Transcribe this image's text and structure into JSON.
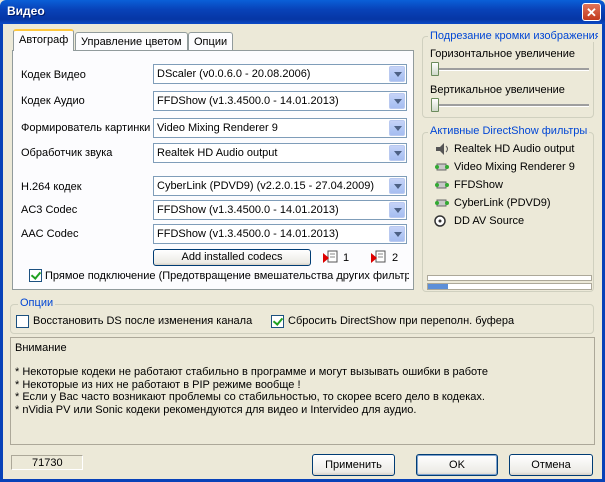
{
  "window": {
    "title": "Видео",
    "close": "✕"
  },
  "tabs": [
    {
      "label": "Автограф"
    },
    {
      "label": "Управление цветом"
    },
    {
      "label": "Опции"
    }
  ],
  "form": {
    "video_codec": {
      "label": "Кодек Видео",
      "value": "DScaler   (v0.0.6.0 - 20.08.2006)"
    },
    "audio_codec": {
      "label": "Кодек Аудио",
      "value": "FFDShow   (v1.3.4500.0 - 14.01.2013)"
    },
    "renderer": {
      "label": "Формирователь картинки",
      "value": "Video Mixing Renderer 9"
    },
    "audio_handler": {
      "label": "Обработчик звука",
      "value": "Realtek HD Audio output"
    },
    "h264": {
      "label": "H.264 кодек",
      "value": "CyberLink (PDVD9)   (v2.2.0.15 - 27.04.2009)"
    },
    "ac3": {
      "label": "AC3 Codec",
      "value": "FFDShow   (v1.3.4500.0 - 14.01.2013)"
    },
    "aac": {
      "label": "AAC Codec",
      "value": "FFDShow   (v1.3.4500.0 - 14.01.2013)"
    },
    "add_codecs_label": "Add installed codecs",
    "counter1": "1",
    "counter2": "2",
    "direct_connect": {
      "label": "Прямое подключение (Предотвращение вмешательства других фильтр",
      "checked": true
    }
  },
  "crop": {
    "title": "Подрезание кромки изображения",
    "horizontal_label": "Горизонтальное увеличение",
    "vertical_label": "Вертикальное увеличение",
    "horizontal_value": 0,
    "vertical_value": 0
  },
  "filters": {
    "title": "Активные DirectShow фильтры",
    "items": [
      {
        "label": "Realtek HD Audio output",
        "icon": "speaker-icon"
      },
      {
        "label": "Video Mixing Renderer 9",
        "icon": "filter-icon"
      },
      {
        "label": "FFDShow",
        "icon": "filter-icon"
      },
      {
        "label": "CyberLink (PDVD9)",
        "icon": "filter-icon"
      },
      {
        "label": "DD AV Source",
        "icon": "disc-icon"
      }
    ]
  },
  "options": {
    "title": "Опции",
    "restore_ds": {
      "label": "Восстановить DS после изменения канала",
      "checked": false
    },
    "reset_ds": {
      "label": "Сбросить DirectShow при переполн. буфера",
      "checked": true
    }
  },
  "notes": {
    "heading": "Внимание",
    "lines": [
      "*  Некоторые кодеки не работают стабильно в программе и могут вызывать ошибки в работе",
      "*  Некоторые из них не работают в PIP режиме вообще !",
      "*  Если у Вас часто возникают проблемы со стабильностью, то скорее всего дело в кодеках.",
      "*  nVidia PV или Sonic кодеки рекомендуются для видео и Intervideo для аудио."
    ]
  },
  "footer": {
    "status": "71730",
    "apply": "Применить",
    "ok": "OK",
    "cancel": "Отмена"
  },
  "colors": {
    "title_bar": "#0842b8",
    "group_title": "#0046d5",
    "dialog_bg": "#ece9d8"
  }
}
